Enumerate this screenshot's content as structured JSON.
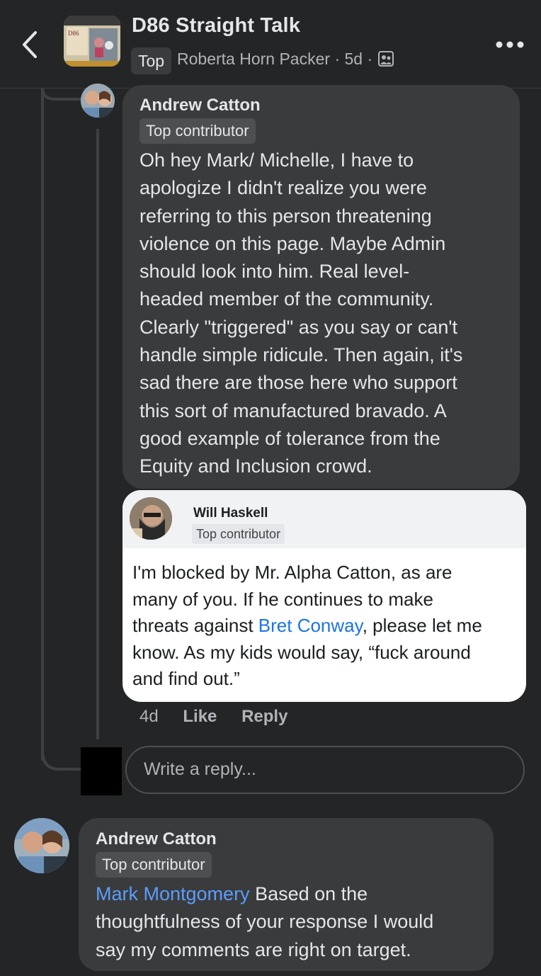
{
  "header": {
    "group_name": "D86 Straight Talk",
    "sort_label": "Top",
    "author": "Roberta Horn Packer",
    "dot1": "·",
    "age": "5d",
    "dot2": "·",
    "thumb_text": "D86"
  },
  "comment1": {
    "name": "Andrew Catton",
    "badge": "Top contributor",
    "lines": [
      "Oh hey Mark/ Michelle, I have to",
      "apologize I didn't realize you were",
      "referring to this person threatening",
      "violence on this page. Maybe Admin",
      "should look into him.  Real level-",
      "headed member of the community.",
      "Clearly \"triggered\" as you say or can't",
      "handle simple ridicule. Then again, it's",
      "sad there are those here who support",
      "this sort of manufactured bravado. A",
      "good example of tolerance from the",
      "Equity and Inclusion crowd."
    ]
  },
  "screenshot_card": {
    "name": "Will Haskell",
    "badge": "Top contributor",
    "line1": "I'm blocked by Mr. Alpha Catton, as are",
    "line2": "many of you. If he continues to make",
    "line3_pre": "threats against ",
    "line3_mention": "Bret Conway",
    "line3_post": ", please let me",
    "line4": "know. As my kids would say, “fuck around",
    "line5": "and find out.”"
  },
  "actions": {
    "time": "4d",
    "like": "Like",
    "reply": "Reply"
  },
  "reply_box": {
    "placeholder": "Write a reply..."
  },
  "comment2": {
    "name": "Andrew Catton",
    "badge": "Top contributor",
    "mention": "Mark Montgomery",
    "line1_post": " Based on the",
    "line2": "thoughtfulness of your response I would",
    "line3": "say my comments are right on target."
  }
}
